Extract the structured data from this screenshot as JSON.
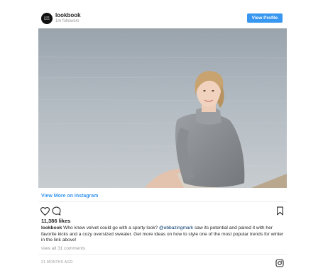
{
  "header": {
    "avatar_text": "LOOK BOOK",
    "username": "lookbook",
    "followers": "1m followers",
    "view_profile_label": "View Profile"
  },
  "post": {
    "view_more_label": "View More on Instagram",
    "likes": "11,386 likes",
    "caption_user": "lookbook",
    "caption_part1": " Who knew velvet could go with a sporty look? ",
    "caption_mention": "@ebbazingmark",
    "caption_part2": " saw its potential and paired it with her favorite kicks and a cozy oversized sweater. Get more ideas on how to style one of the most popular trends for winter in the link above!",
    "comments_link": "view all 31 comments",
    "timestamp": "21 MONTHS AGO"
  },
  "icons": [
    "heart-icon",
    "comment-icon",
    "bookmark-icon",
    "instagram-icon"
  ],
  "colors": {
    "accent": "#3897f0",
    "text": "#262626",
    "muted": "#999999"
  }
}
